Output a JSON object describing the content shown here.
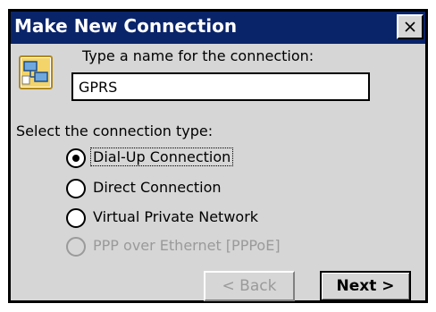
{
  "window": {
    "title": "Make New Connection"
  },
  "name_section": {
    "label": "Type a name for the connection:",
    "value": "GPRS"
  },
  "type_section": {
    "label": "Select the connection type:",
    "options": [
      {
        "label": "Dial-Up Connection",
        "selected": true,
        "enabled": true
      },
      {
        "label": "Direct Connection",
        "selected": false,
        "enabled": true
      },
      {
        "label": "Virtual Private Network",
        "selected": false,
        "enabled": true
      },
      {
        "label": "PPP over Ethernet [PPPoE]",
        "selected": false,
        "enabled": false
      }
    ]
  },
  "buttons": {
    "back_label": "< Back",
    "next_label": "Next >"
  },
  "icons": {
    "close": "close-icon",
    "connection": "network-connection-icon"
  },
  "colors": {
    "titlebar": "#0a246a",
    "dialog_face": "#d6d6d6",
    "disabled_text": "#9a9a9a"
  }
}
